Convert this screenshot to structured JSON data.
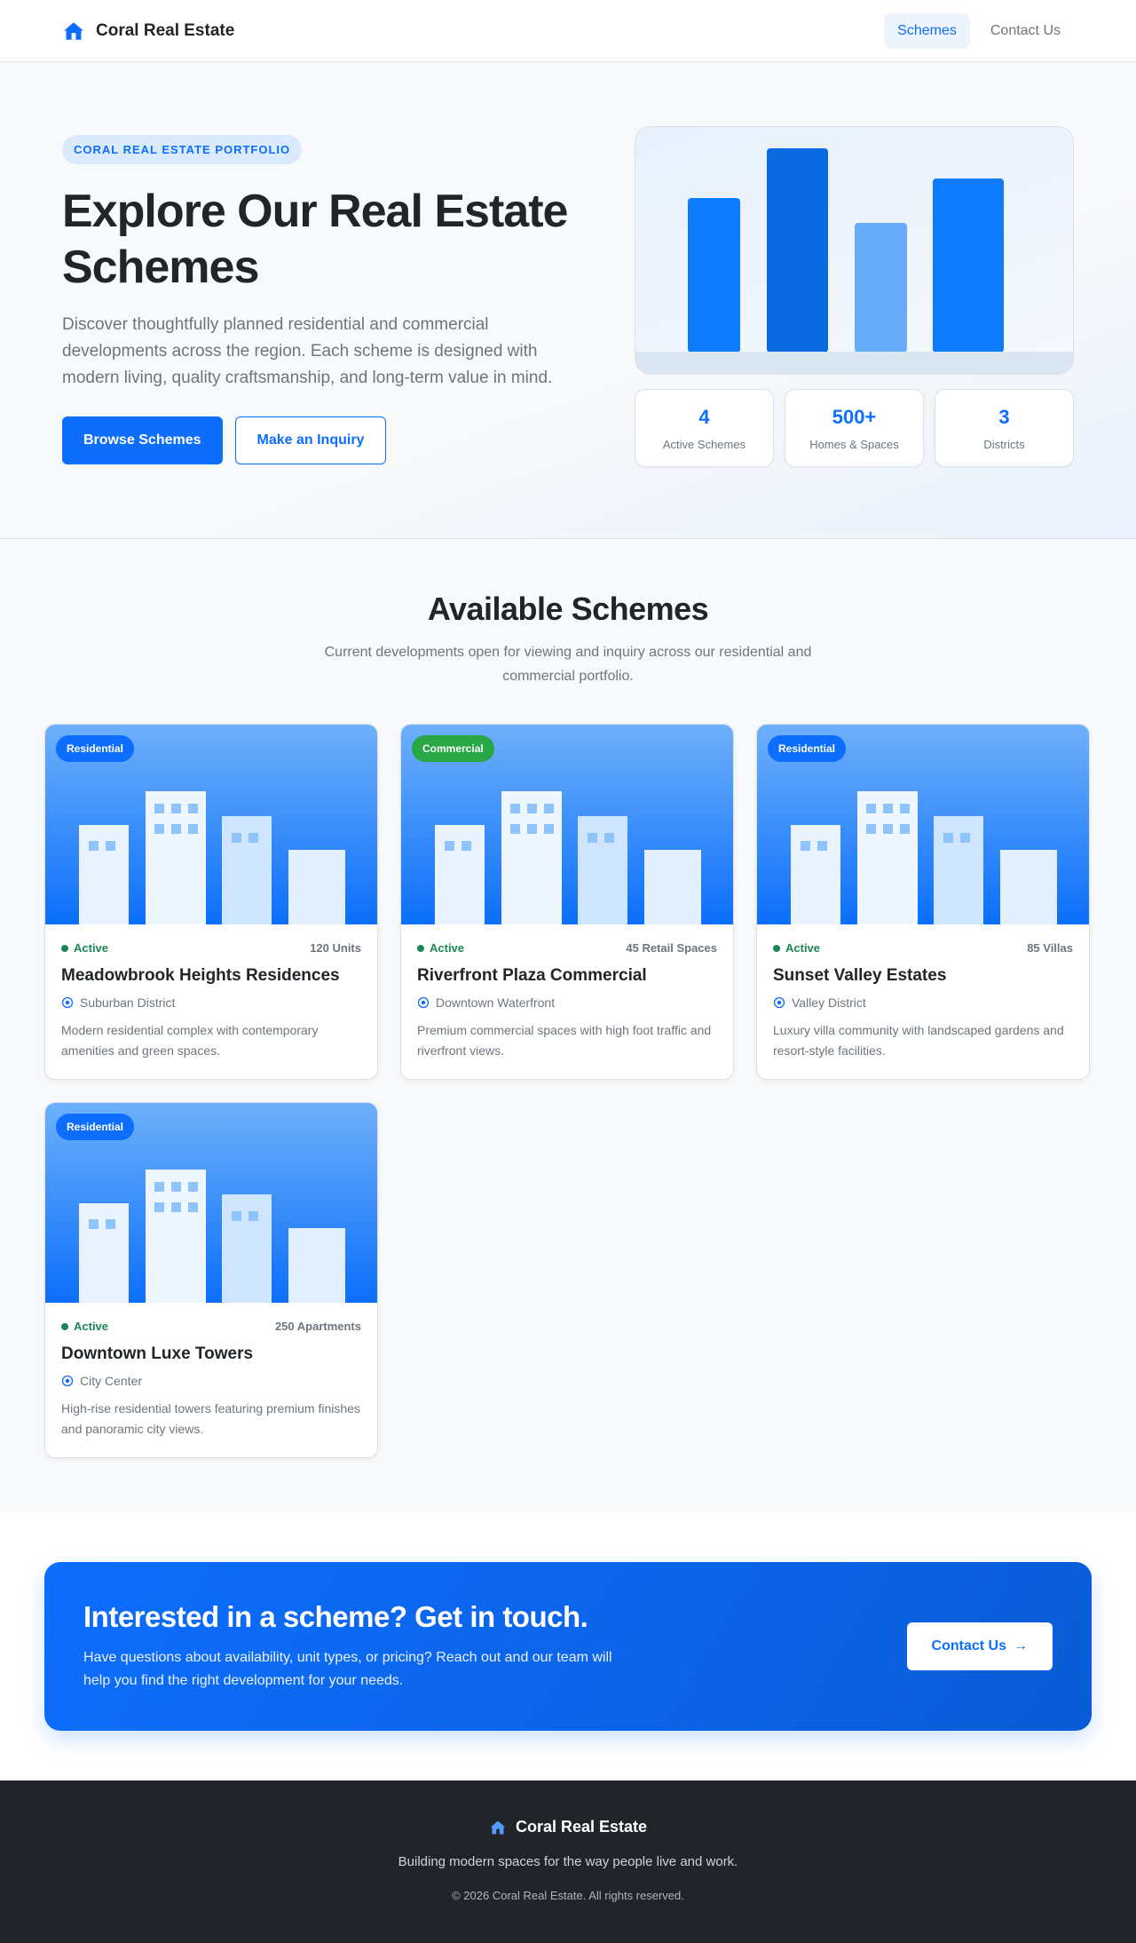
{
  "brand": {
    "name": "Coral Real Estate"
  },
  "nav": [
    {
      "label": "Schemes",
      "active": true
    },
    {
      "label": "Contact Us",
      "active": false
    }
  ],
  "hero": {
    "badge": "CORAL REAL ESTATE PORTFOLIO",
    "title": "Explore Our Real Estate Schemes",
    "description": "Discover thoughtfully planned residential and commercial developments across the region. Each scheme is designed with modern living, quality craftsmanship, and long-term value in mind.",
    "primary_button": "Browse Schemes",
    "secondary_button": "Make an Inquiry",
    "stats": [
      {
        "value": "4",
        "label": "Active Schemes"
      },
      {
        "value": "500+",
        "label": "Homes & Spaces"
      },
      {
        "value": "3",
        "label": "Districts"
      }
    ]
  },
  "schemes": {
    "title": "Available Schemes",
    "subtitle": "Current developments open for viewing and inquiry across our residential and commercial portfolio.",
    "items": [
      {
        "tag": "Residential",
        "status": "Active",
        "units": "120 Units",
        "title": "Meadowbrook Heights Residences",
        "location": "Suburban District",
        "description": "Modern residential complex with contemporary amenities and green spaces."
      },
      {
        "tag": "Commercial",
        "status": "Active",
        "units": "45 Retail Spaces",
        "title": "Riverfront Plaza Commercial",
        "location": "Downtown Waterfront",
        "description": "Premium commercial spaces with high foot traffic and riverfront views."
      },
      {
        "tag": "Residential",
        "status": "Active",
        "units": "85 Villas",
        "title": "Sunset Valley Estates",
        "location": "Valley District",
        "description": "Luxury villa community with landscaped gardens and resort-style facilities."
      },
      {
        "tag": "Residential",
        "status": "Active",
        "units": "250 Apartments",
        "title": "Downtown Luxe Towers",
        "location": "City Center",
        "description": "High-rise residential towers featuring premium finishes and panoramic city views."
      }
    ]
  },
  "cta": {
    "title": "Interested in a scheme? Get in touch.",
    "text": "Have questions about availability, unit types, or pricing? Reach out and our team will help you find the right development for your needs.",
    "button": "Contact Us",
    "button_arrow": "→"
  },
  "footer": {
    "name": "Coral Real Estate",
    "tagline": "Building modern spaces for the way people live and work.",
    "copyright": "© 2026 Coral Real Estate. All rights reserved."
  },
  "colors": {
    "primary": "#0d6efd",
    "success": "#198754",
    "commercial_tag": "#28a745",
    "footer_bg": "#212529"
  },
  "icons": {
    "brand": "house-icon",
    "location": "location-pin-icon"
  }
}
